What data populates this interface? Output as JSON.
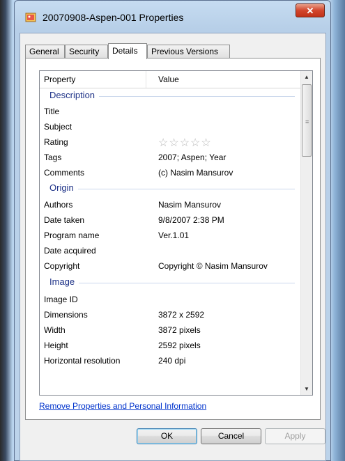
{
  "window": {
    "title": "20070908-Aspen-001 Properties",
    "close_glyph": "✕"
  },
  "tabs": [
    {
      "label": "General"
    },
    {
      "label": "Security"
    },
    {
      "label": "Details"
    },
    {
      "label": "Previous Versions"
    }
  ],
  "columns": {
    "property": "Property",
    "value": "Value"
  },
  "sections": {
    "description": "Description",
    "origin": "Origin",
    "image": "Image"
  },
  "rows": {
    "title": {
      "name": "Title",
      "value": ""
    },
    "subject": {
      "name": "Subject",
      "value": ""
    },
    "rating": {
      "name": "Rating",
      "value": "☆☆☆☆☆"
    },
    "tags": {
      "name": "Tags",
      "value": "2007; Aspen; Year"
    },
    "comments": {
      "name": "Comments",
      "value": "(c) Nasim Mansurov"
    },
    "authors": {
      "name": "Authors",
      "value": "Nasim Mansurov"
    },
    "date_taken": {
      "name": "Date taken",
      "value": "9/8/2007 2:38 PM"
    },
    "program_name": {
      "name": "Program name",
      "value": "Ver.1.01"
    },
    "date_acquired": {
      "name": "Date acquired",
      "value": ""
    },
    "copyright": {
      "name": "Copyright",
      "value": "Copyright © Nasim Mansurov"
    },
    "image_id": {
      "name": "Image ID",
      "value": ""
    },
    "dimensions": {
      "name": "Dimensions",
      "value": "3872 x 2592"
    },
    "width": {
      "name": "Width",
      "value": "3872 pixels"
    },
    "height": {
      "name": "Height",
      "value": "2592 pixels"
    },
    "hres": {
      "name": "Horizontal resolution",
      "value": "240 dpi"
    }
  },
  "rating_stars": 0,
  "link": "Remove Properties and Personal Information",
  "buttons": {
    "ok": "OK",
    "cancel": "Cancel",
    "apply": "Apply"
  }
}
